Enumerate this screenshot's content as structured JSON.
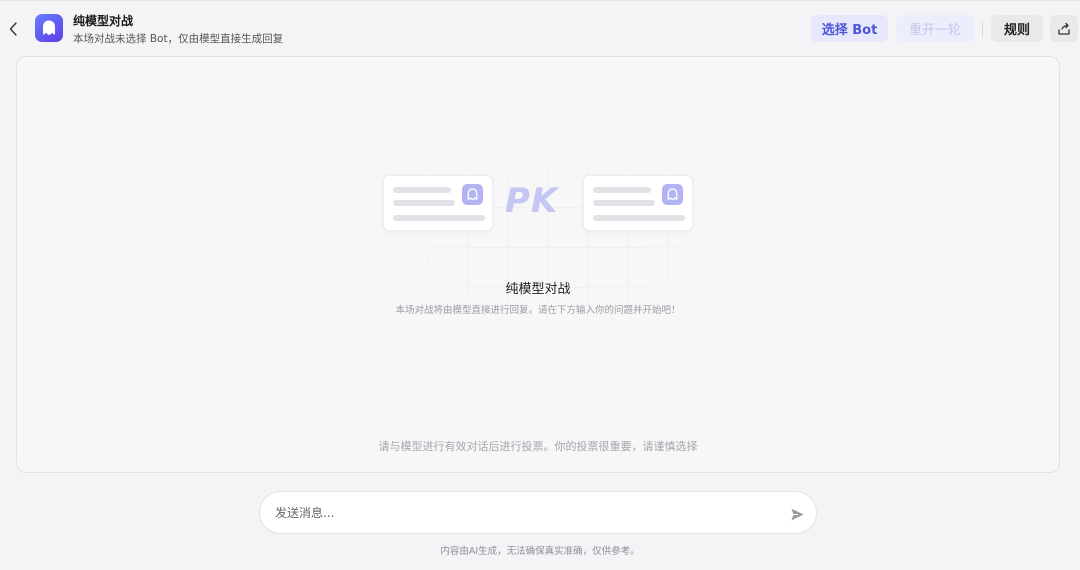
{
  "header": {
    "title": "纯模型对战",
    "subtitle": "本场对战未选择 Bot，仅由模型直接生成回复",
    "select_bot_label": "选择 Bot",
    "restart_label": "重开一轮",
    "rules_label": "规则",
    "icons": {
      "back": "chevron-left-icon",
      "app": "ghost-avatar-icon",
      "share": "share-icon"
    }
  },
  "main": {
    "pk_label": "PK",
    "empty_title": "纯模型对战",
    "empty_desc": "本场对战将由模型直接进行回复。请在下方输入你的问题并开始吧！",
    "vote_hint": "请与模型进行有效对话后进行投票。你的投票很重要，请谨慎选择"
  },
  "composer": {
    "placeholder": "发送消息...",
    "send_icon": "send-icon",
    "disclaimer": "内容由AI生成，无法确保真实准确，仅供参考。"
  },
  "colors": {
    "accent": "#4d55d6",
    "accent_bg": "#e7e8fb",
    "pk": "#c4c6f4",
    "app_icon_from": "#6a7cff",
    "app_icon_to": "#5b3fe6"
  }
}
